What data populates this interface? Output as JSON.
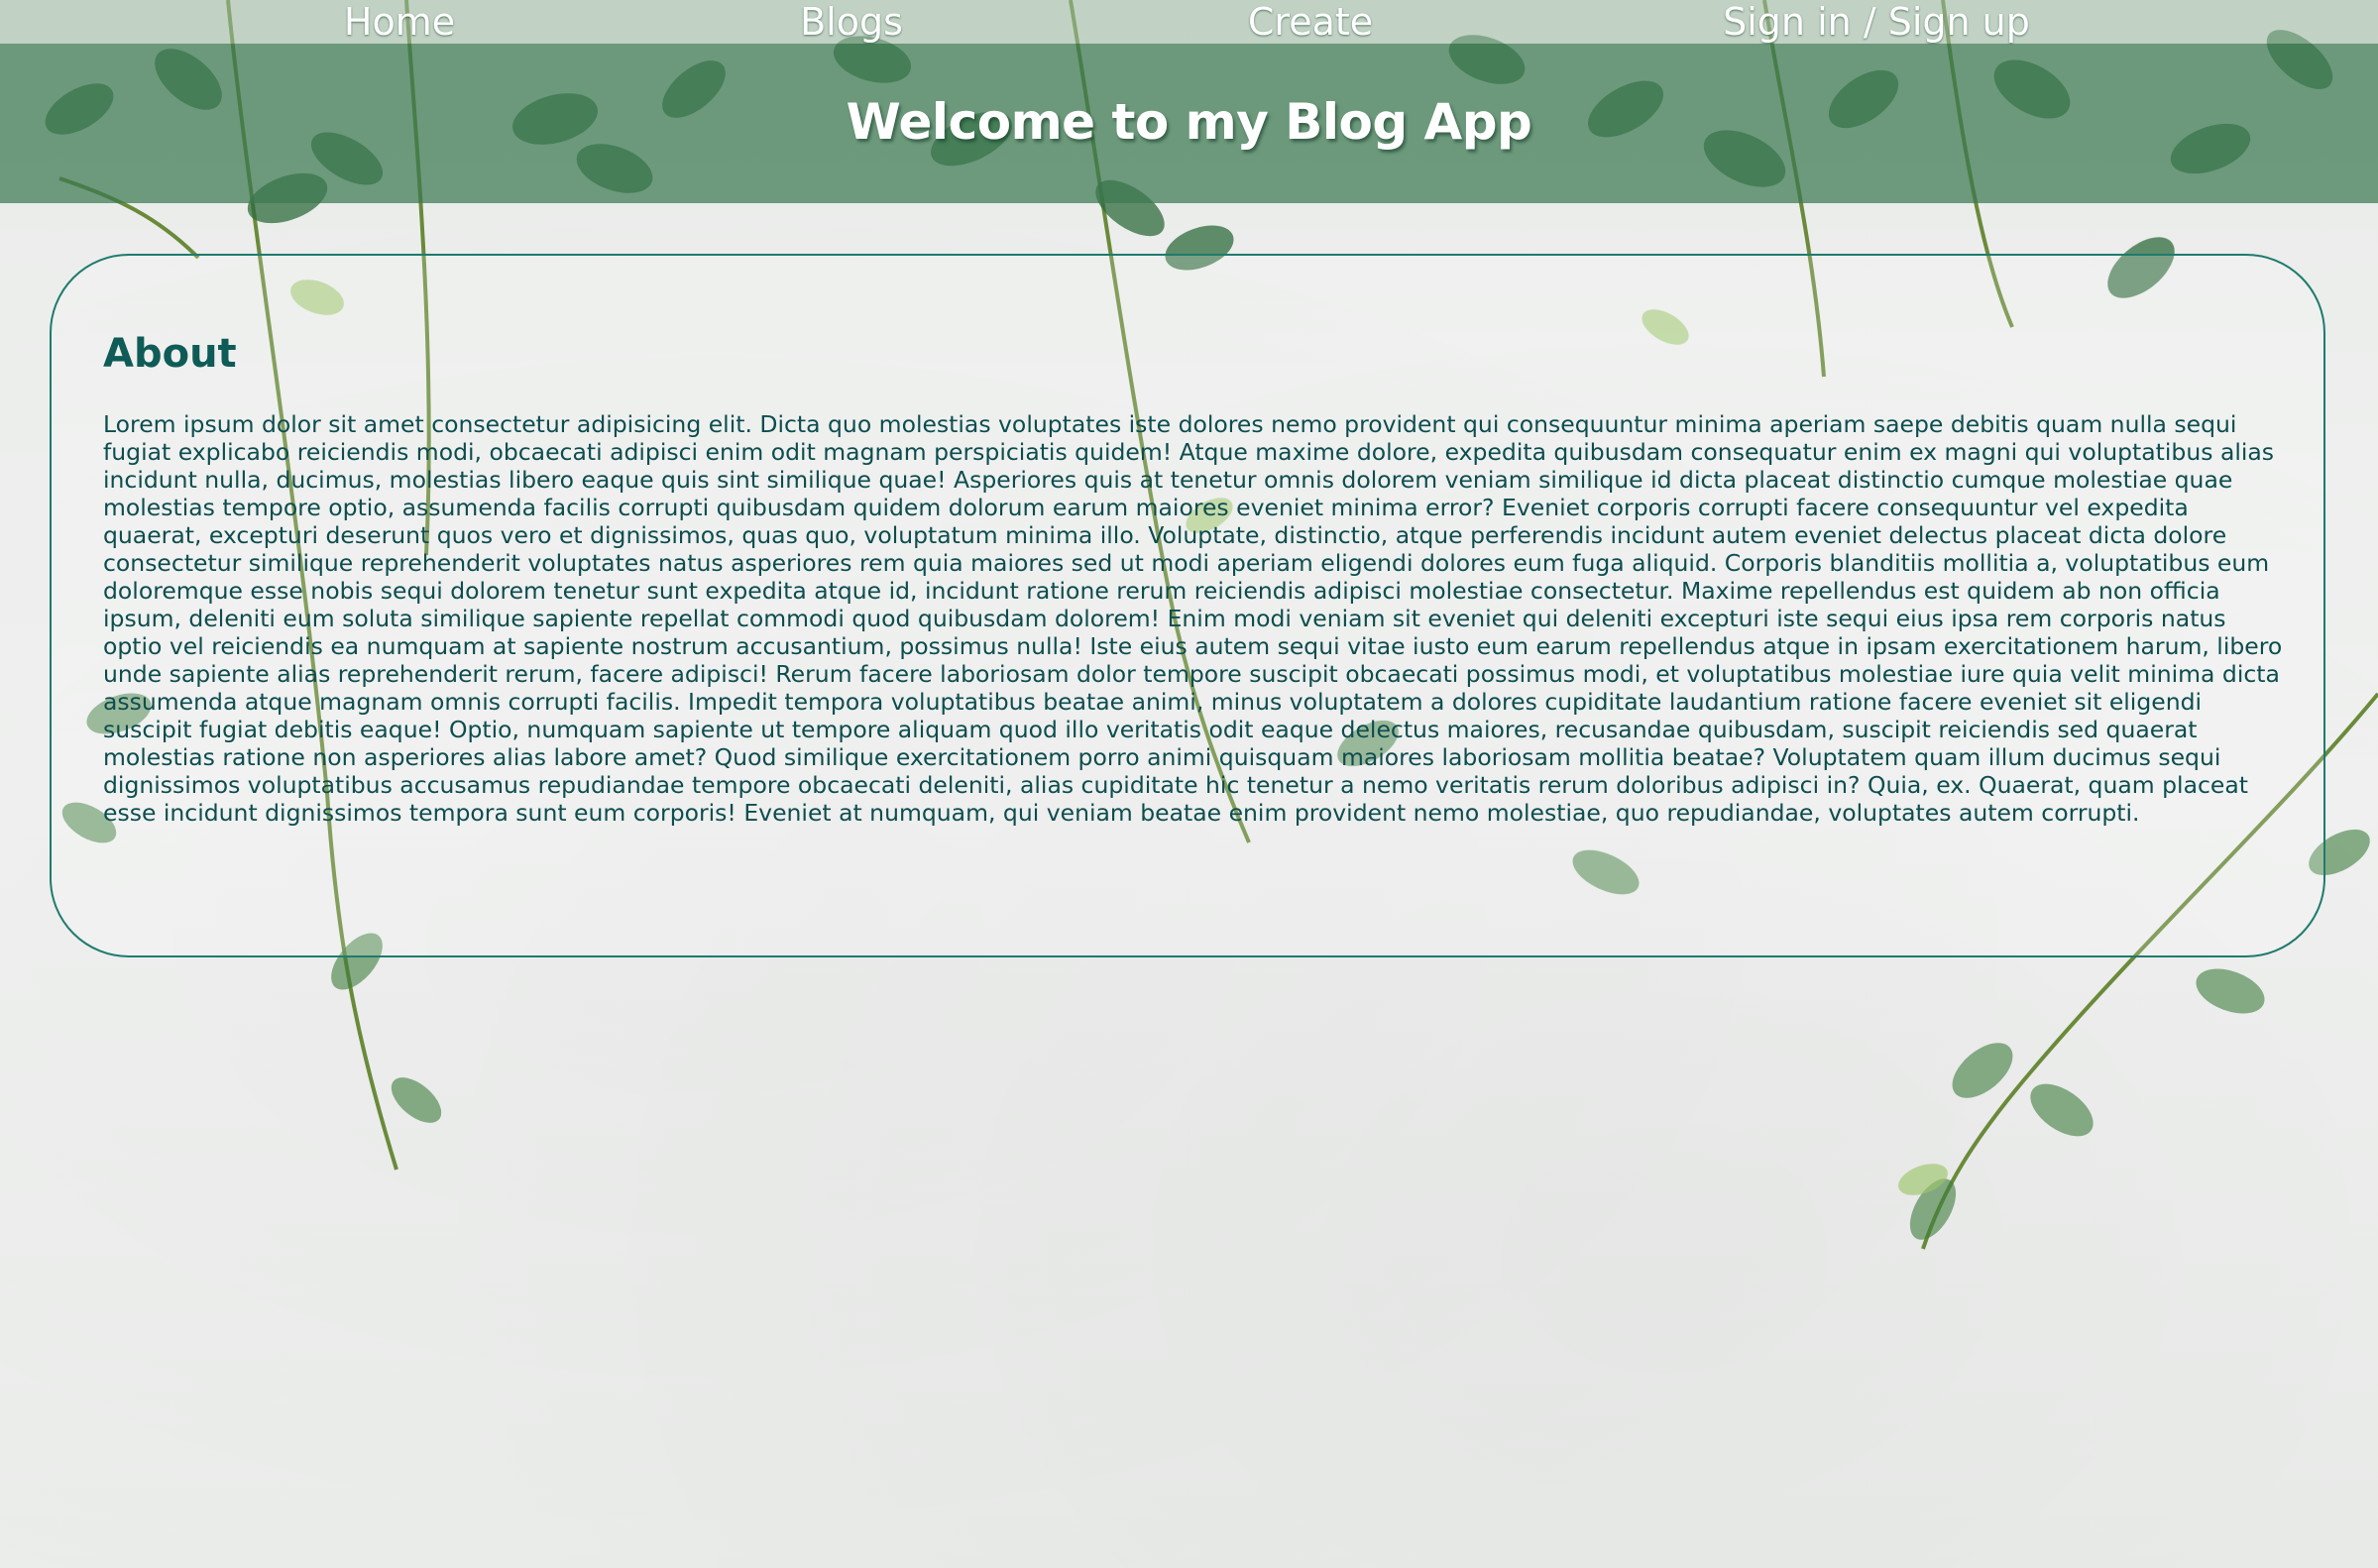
{
  "nav": {
    "items": [
      {
        "label": "Home"
      },
      {
        "label": "Blogs"
      },
      {
        "label": "Create"
      },
      {
        "label": "Sign in / Sign up"
      }
    ]
  },
  "header": {
    "title": "Welcome to my Blog App"
  },
  "about": {
    "heading": "About",
    "body": "Lorem ipsum dolor sit amet consectetur adipisicing elit. Dicta quo molestias voluptates iste dolores nemo provident qui consequuntur minima aperiam saepe debitis quam nulla sequi fugiat explicabo reiciendis modi, obcaecati adipisci enim odit magnam perspiciatis quidem! Atque maxime dolore, expedita quibusdam consequatur enim ex magni qui voluptatibus alias incidunt nulla, ducimus, molestias libero eaque quis sint similique quae! Asperiores quis at tenetur omnis dolorem veniam similique id dicta placeat distinctio cumque molestiae quae molestias tempore optio, assumenda facilis corrupti quibusdam quidem dolorum earum maiores eveniet minima error? Eveniet corporis corrupti facere consequuntur vel expedita quaerat, excepturi deserunt quos vero et dignissimos, quas quo, voluptatum minima illo. Voluptate, distinctio, atque perferendis incidunt autem eveniet delectus placeat dicta dolore consectetur similique reprehenderit voluptates natus asperiores rem quia maiores sed ut modi aperiam eligendi dolores eum fuga aliquid. Corporis blanditiis mollitia a, voluptatibus eum doloremque esse nobis sequi dolorem tenetur sunt expedita atque id, incidunt ratione rerum reiciendis adipisci molestiae consectetur. Maxime repellendus est quidem ab non officia ipsum, deleniti eum soluta similique sapiente repellat commodi quod quibusdam dolorem! Enim modi veniam sit eveniet qui deleniti excepturi iste sequi eius ipsa rem corporis natus optio vel reiciendis ea numquam at sapiente nostrum accusantium, possimus nulla! Iste eius autem sequi vitae iusto eum earum repellendus atque in ipsam exercitationem harum, libero unde sapiente alias reprehenderit rerum, facere adipisci! Rerum facere laboriosam dolor tempore suscipit obcaecati possimus modi, et voluptatibus molestiae iure quia velit minima dicta assumenda atque magnam omnis corrupti facilis. Impedit tempora voluptatibus beatae animi, minus voluptatem a dolores cupiditate laudantium ratione facere eveniet sit eligendi suscipit fugiat debitis eaque! Optio, numquam sapiente ut tempore aliquam quod illo veritatis odit eaque delectus maiores, recusandae quibusdam, suscipit reiciendis sed quaerat molestias ratione non asperiores alias labore amet? Quod similique exercitationem porro animi quisquam maiores laboriosam mollitia beatae? Voluptatem quam illum ducimus sequi dignissimos voluptatibus accusamus repudiandae tempore obcaecati deleniti, alias cupiditate hic tenetur a nemo veritatis rerum doloribus adipisci in? Quia, ex. Quaerat, quam placeat esse incidunt dignissimos tempora sunt eum corporis! Eveniet at numquam, qui veniam beatae enim provident nemo molestiae, quo repudiandae, voluptates autem corrupti."
  },
  "colors": {
    "accent": "#1e7b6e",
    "text": "#0d4d4f",
    "header_band": "#3c7850"
  }
}
